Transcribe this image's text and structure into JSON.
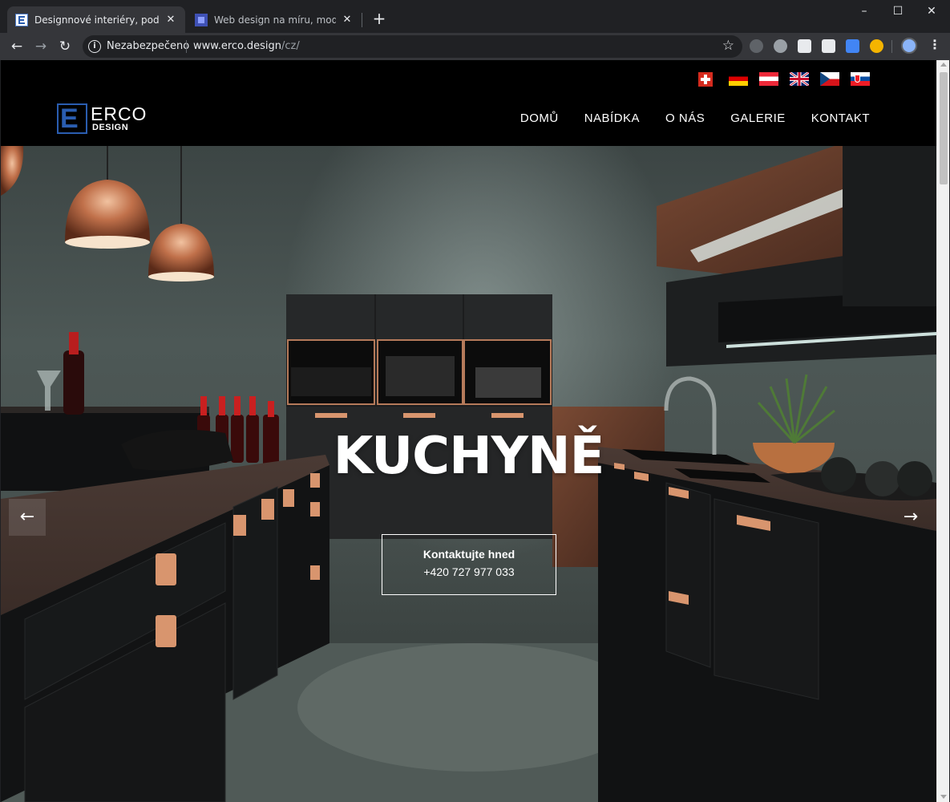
{
  "browser": {
    "tabs": [
      {
        "title": "Designnové interiéry, podlahy, st",
        "favicon_color": "#ffffff",
        "active": true
      },
      {
        "title": "Web design na míru, moderní, re",
        "favicon_color": "#3f51b5",
        "active": false
      }
    ],
    "new_tab_icon": "+",
    "window_controls": {
      "minimize": "–",
      "maximize": "☐",
      "close": "✕"
    },
    "toolbar": {
      "back_icon": "←",
      "forward_icon": "→",
      "reload_icon": "↻",
      "security_label": "Nezabezpečeno",
      "url_host": "www.erco.design",
      "url_path": "/cz/",
      "bookmark_icon": "☆",
      "menu_icon": "⋮"
    },
    "extensions": [
      {
        "name": "lightbulb-extension-icon",
        "color": "#9aa0a6"
      },
      {
        "name": "skype-extension-icon",
        "color": "#9aa0a6"
      },
      {
        "name": "pocket-extension-icon",
        "color": "#e8eaed"
      },
      {
        "name": "reader-extension-icon",
        "color": "#e8eaed"
      },
      {
        "name": "translate-extension-icon",
        "color": "#4285f4"
      },
      {
        "name": "owl-extension-icon",
        "color": "#f4b400"
      }
    ]
  },
  "site": {
    "logo": {
      "letter": "E",
      "brand": "ERCO",
      "sub": "DESIGN",
      "accent": "#2a5db0"
    },
    "flags": [
      "switzerland",
      "germany",
      "austria",
      "united-kingdom",
      "czech-republic",
      "slovakia"
    ],
    "nav": [
      "DOMŮ",
      "NABÍDKA",
      "O NÁS",
      "GALERIE",
      "KONTAKT"
    ],
    "hero": {
      "title": "KUCHYNĚ",
      "cta_line1": "Kontaktujte hned",
      "cta_line2": "+420 727 977 033",
      "prev_icon": "←",
      "next_icon": "→"
    }
  }
}
